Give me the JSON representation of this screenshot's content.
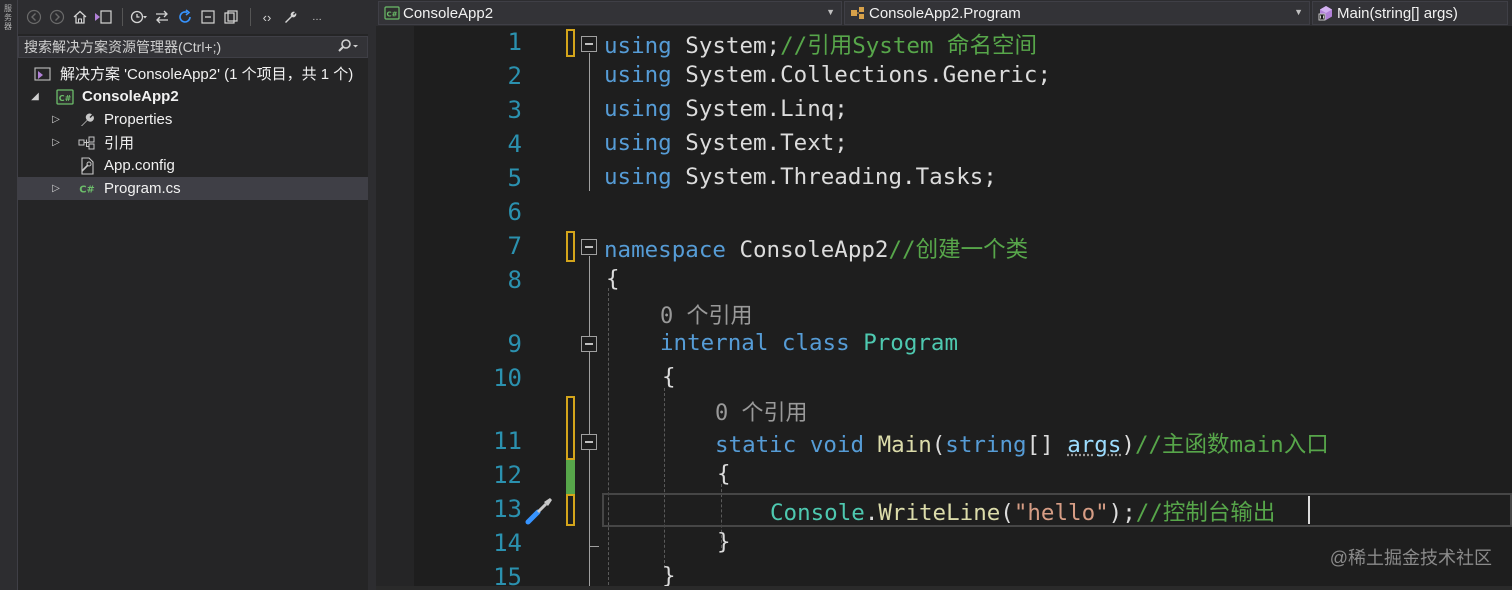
{
  "side_strip": {
    "label": "服务器"
  },
  "solution_explorer": {
    "search_placeholder": "搜索解决方案资源管理器(Ctrl+;)",
    "tree": [
      {
        "label": "解决方案 'ConsoleApp2' (1 个项目，共 1 个)",
        "icon": "solution-icon",
        "depth": 0,
        "expander": ""
      },
      {
        "label": "ConsoleApp2",
        "icon": "csharp-project-icon",
        "depth": 1,
        "expander": "expanded",
        "bold": true
      },
      {
        "label": "Properties",
        "icon": "wrench-icon",
        "depth": 2,
        "expander": "collapsed"
      },
      {
        "label": "引用",
        "icon": "references-icon",
        "depth": 2,
        "expander": "collapsed"
      },
      {
        "label": "App.config",
        "icon": "config-file-icon",
        "depth": 2,
        "expander": ""
      },
      {
        "label": "Program.cs",
        "icon": "csharp-file-icon",
        "depth": 2,
        "expander": "collapsed",
        "selected": true
      }
    ]
  },
  "navbar": {
    "project": "ConsoleApp2",
    "type": "ConsoleApp2.Program",
    "member": "Main(string[] args)"
  },
  "editor": {
    "line_numbers": [
      "1",
      "2",
      "3",
      "4",
      "5",
      "6",
      "7",
      "8",
      "9",
      "10",
      "11",
      "12",
      "13",
      "14",
      "15"
    ],
    "lens_refs": "0 个引用",
    "lines": {
      "l1": {
        "kw": "using",
        "rest": " System;",
        "comment": "//引用System 命名空间"
      },
      "l2": {
        "kw": "using",
        "rest": " System.Collections.Generic;"
      },
      "l3": {
        "kw": "using",
        "rest": " System.Linq;"
      },
      "l4": {
        "kw": "using",
        "rest": " System.Text;"
      },
      "l5": {
        "kw": "using",
        "rest": " System.Threading.Tasks;"
      },
      "l7": {
        "kw": "namespace",
        "rest": " ConsoleApp2",
        "comment": "//创建一个类"
      },
      "l8": {
        "text": "{"
      },
      "l9": {
        "kw1": "internal",
        "kw2": "class",
        "type": "Program"
      },
      "l10": {
        "text": "{"
      },
      "l11": {
        "kw1": "static",
        "kw2": "void",
        "method": "Main",
        "open": "(",
        "kw3": "string",
        "mid": "[] ",
        "param": "args",
        "close": ")",
        "comment": "//主函数main入口"
      },
      "l12": {
        "text": "{"
      },
      "l13": {
        "type": "Console",
        "dot": ".",
        "method": "WriteLine",
        "open": "(",
        "str": "\"hello\"",
        "close": ");",
        "comment": "//控制台输出"
      },
      "l14": {
        "text": "}"
      },
      "l15": {
        "text": "}"
      }
    }
  },
  "watermark": "@稀土掘金技术社区",
  "colors": {
    "keyword": "#569cd6",
    "type": "#4ec9b0",
    "comment": "#57a64a",
    "string": "#d69d85",
    "method": "#dcdcaa",
    "line_number": "#2b91af",
    "saved_change": "#d4a51b",
    "unsaved_change": "#57a64a"
  }
}
